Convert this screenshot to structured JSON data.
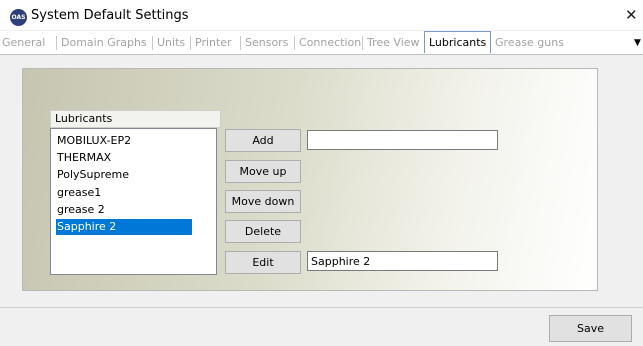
{
  "window": {
    "title": "System Default Settings",
    "app_icon_text": "OAS",
    "close_glyph": "✕"
  },
  "tabs": [
    {
      "label": "General"
    },
    {
      "label": "Domain Graphs"
    },
    {
      "label": "Units"
    },
    {
      "label": "Printer"
    },
    {
      "label": "Sensors"
    },
    {
      "label": "Connection"
    },
    {
      "label": "Tree View"
    },
    {
      "label": "Lubricants",
      "active": true
    },
    {
      "label": "Grease guns"
    }
  ],
  "lubricants": {
    "caption": "Lubricants",
    "items": [
      "MOBILUX-EP2",
      "THERMAX",
      "PolySupreme",
      "grease1",
      "grease 2",
      "Sapphire 2"
    ],
    "selected": "Sapphire 2"
  },
  "buttons": {
    "add": "Add",
    "move_up": "Move up",
    "move_down": "Move down",
    "delete": "Delete",
    "edit": "Edit",
    "save": "Save"
  },
  "fields": {
    "add_value": "",
    "edit_value": "Sapphire 2"
  },
  "colors": {
    "selection": "#0078d7",
    "active_tab_border": "#7a9ac3"
  }
}
